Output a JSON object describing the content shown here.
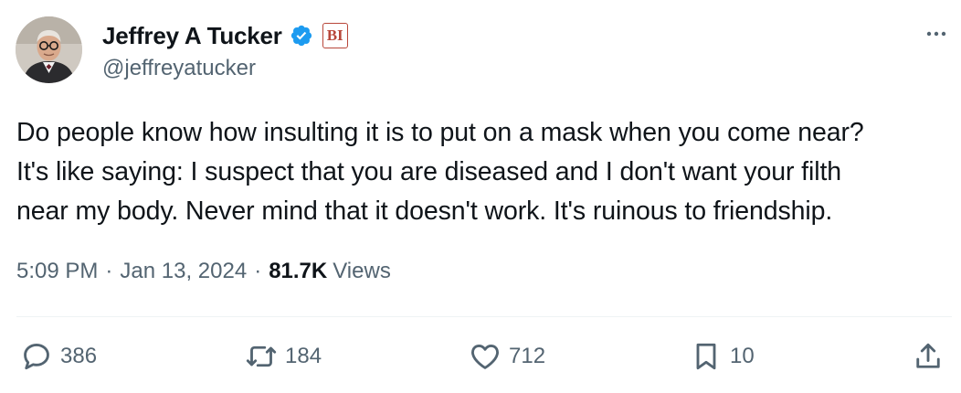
{
  "author": {
    "display_name": "Jeffrey A Tucker",
    "handle": "@jeffreyatucker",
    "verified": true,
    "affiliation_badge_text": "BI"
  },
  "tweet": {
    "lines": [
      "Do people know how insulting it is to put on a mask when you come near?",
      "It's like saying: I suspect that you are diseased and I don't want your filth",
      "near my body. Never mind that it doesn't work. It's ruinous to friendship."
    ],
    "time": "5:09 PM",
    "date": "Jan 13, 2024",
    "separator": "·",
    "views_count": "81.7K",
    "views_label": "Views"
  },
  "actions": {
    "replies": "386",
    "reposts": "184",
    "likes": "712",
    "bookmarks": "10"
  },
  "colors": {
    "text": "#0f1419",
    "secondary": "#536471",
    "verified_blue": "#1d9bf0",
    "affiliation_red": "#b8473a",
    "divider": "#eff3f4"
  },
  "icons": {
    "more": "more-dots-icon",
    "reply": "reply-bubble-icon",
    "repost": "repost-arrows-icon",
    "like": "heart-icon",
    "bookmark": "bookmark-icon",
    "share": "share-upload-icon",
    "verified": "verified-badge-icon"
  }
}
